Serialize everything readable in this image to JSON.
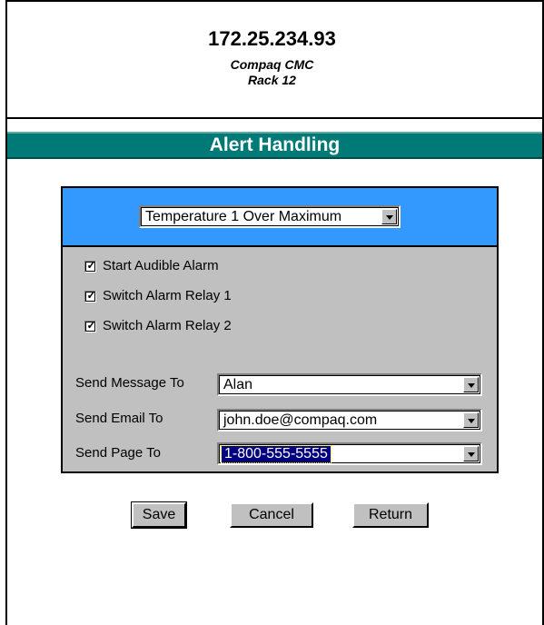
{
  "header": {
    "ip": "172.25.234.93",
    "device": "Compaq CMC",
    "rack": "Rack 12"
  },
  "title": "Alert Handling",
  "alert_select": {
    "value": "Temperature 1 Over Maximum"
  },
  "checkboxes": [
    {
      "label": "Start Audible Alarm",
      "checked": true
    },
    {
      "label": "Switch Alarm Relay 1",
      "checked": true
    },
    {
      "label": "Switch Alarm Relay 2",
      "checked": true
    }
  ],
  "fields": [
    {
      "label": "Send Message To",
      "value": "Alan"
    },
    {
      "label": "Send Email To",
      "value": "john.doe@compaq.com"
    },
    {
      "label": "Send Page To",
      "value": "1-800-555-5555"
    }
  ],
  "buttons": {
    "save": "Save",
    "cancel": "Cancel",
    "return": "Return"
  },
  "colors": {
    "title_bar": "#007a76",
    "panel_head": "#3399ff",
    "panel_body": "#c0c0c0",
    "selection": "#000080"
  }
}
